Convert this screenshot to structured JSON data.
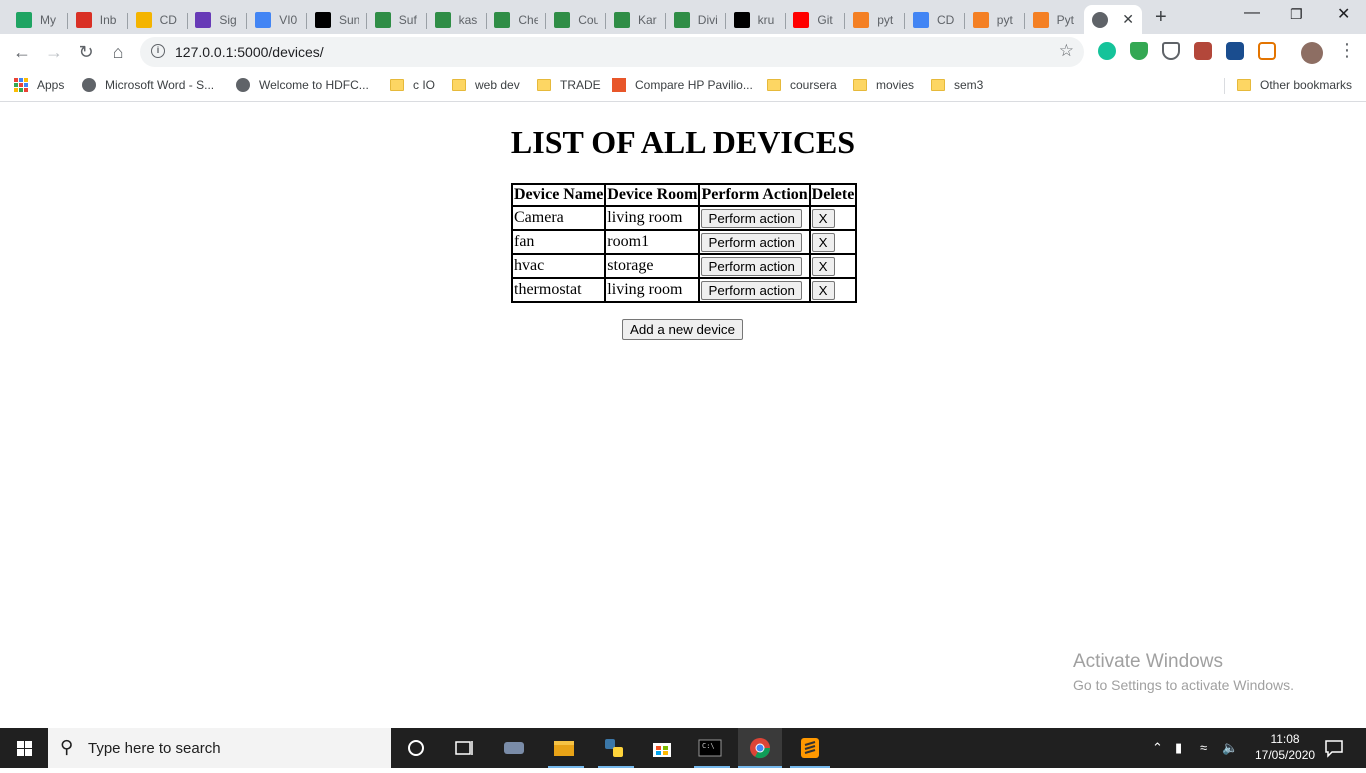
{
  "browser": {
    "tabs": [
      {
        "label": "My",
        "icon": "drive-icon",
        "color": "#1fa463"
      },
      {
        "label": "Inb",
        "icon": "gmail-icon",
        "color": "#d93025"
      },
      {
        "label": "CD",
        "icon": "slides-icon",
        "color": "#f4b400"
      },
      {
        "label": "Sig",
        "icon": "forms-icon",
        "color": "#673ab7"
      },
      {
        "label": "VI0",
        "icon": "docs-icon",
        "color": "#4285f4"
      },
      {
        "label": "Sun",
        "icon": "hackerrank-icon",
        "color": "#000000"
      },
      {
        "label": "Suf",
        "icon": "gfg-icon",
        "color": "#2f8d46"
      },
      {
        "label": "kas",
        "icon": "gfg-icon",
        "color": "#2f8d46"
      },
      {
        "label": "Che",
        "icon": "gfg-icon",
        "color": "#2f8d46"
      },
      {
        "label": "Cou",
        "icon": "gfg-icon",
        "color": "#2f8d46"
      },
      {
        "label": "Kar",
        "icon": "gfg-icon",
        "color": "#2f8d46"
      },
      {
        "label": "Divi",
        "icon": "gfg-icon",
        "color": "#2f8d46"
      },
      {
        "label": "kru",
        "icon": "github-icon",
        "color": "#000000"
      },
      {
        "label": "Git",
        "icon": "youtube-icon",
        "color": "#ff0000"
      },
      {
        "label": "pyt",
        "icon": "stackoverflow-icon",
        "color": "#f48024"
      },
      {
        "label": "CD",
        "icon": "docs-icon",
        "color": "#4285f4"
      },
      {
        "label": "pyt",
        "icon": "stackoverflow-icon",
        "color": "#f48024"
      },
      {
        "label": "Pyt",
        "icon": "stackoverflow-icon",
        "color": "#f48024"
      }
    ],
    "url": "127.0.0.1:5000/devices/",
    "bookmarks": [
      {
        "label": "Apps",
        "type": "apps"
      },
      {
        "label": "Microsoft Word - S...",
        "type": "globe"
      },
      {
        "label": "Welcome to HDFC...",
        "type": "globe"
      },
      {
        "label": "c IO",
        "type": "folder"
      },
      {
        "label": "web dev",
        "type": "folder"
      },
      {
        "label": "TRADE",
        "type": "folder"
      },
      {
        "label": "Compare HP Pavilio...",
        "type": "site91"
      },
      {
        "label": "coursera",
        "type": "folder"
      },
      {
        "label": "movies",
        "type": "folder"
      },
      {
        "label": "sem3",
        "type": "folder"
      }
    ],
    "other_bookmarks": "Other bookmarks"
  },
  "page": {
    "title": "LIST OF ALL DEVICES",
    "table": {
      "headers": [
        "Device Name",
        "Device Room",
        "Perform Action",
        "Delete"
      ],
      "rows": [
        {
          "name": "Camera",
          "room": "living room",
          "action": "Perform action",
          "delete": "X"
        },
        {
          "name": "fan",
          "room": "room1",
          "action": "Perform action",
          "delete": "X"
        },
        {
          "name": "hvac",
          "room": "storage",
          "action": "Perform action",
          "delete": "X"
        },
        {
          "name": "thermostat",
          "room": "living room",
          "action": "Perform action",
          "delete": "X"
        }
      ]
    },
    "add_button": "Add a new device"
  },
  "watermark": {
    "line1": "Activate Windows",
    "line2": "Go to Settings to activate Windows."
  },
  "taskbar": {
    "search_placeholder": "Type here to search",
    "time": "11:08",
    "date": "17/05/2020"
  }
}
